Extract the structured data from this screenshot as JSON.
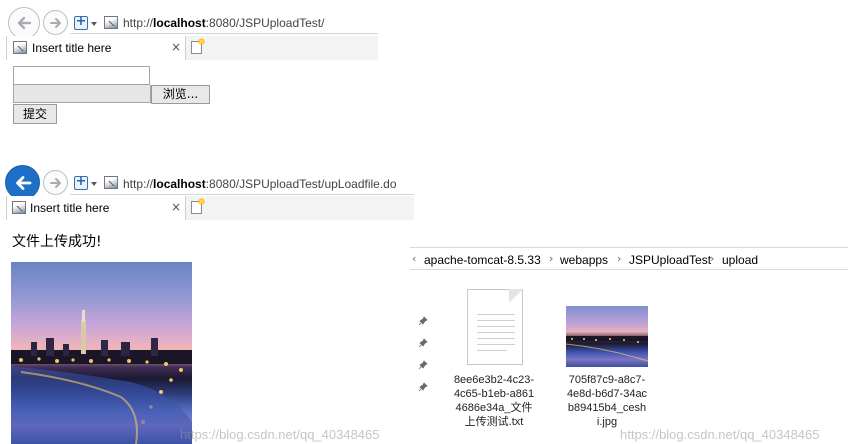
{
  "browser_top": {
    "url_prefix": "http://",
    "url_host": "localhost",
    "url_rest": ":8080/JSPUploadTest/",
    "tab_title": "Insert title here",
    "tab_close": "×"
  },
  "upload_form": {
    "file_text_value": "",
    "browse_label": "浏览...",
    "submit_label": "提交"
  },
  "browser_bottom": {
    "url_prefix": "http://",
    "url_host": "localhost",
    "url_rest": ":8080/JSPUploadTest/upLoadfile.do",
    "tab_title": "Insert title here",
    "tab_close": "×"
  },
  "result": {
    "message": "文件上传成功!"
  },
  "explorer": {
    "back_chevron": "‹",
    "breadcrumbs": [
      "apache-tomcat-8.5.33",
      "webapps",
      "JSPUploadTest",
      "upload"
    ],
    "separator": "›",
    "pin_glyph": "📌",
    "files": [
      {
        "type": "text-file",
        "name": "8ee6e3b2-4c23-4c65-b1eb-a8614686e34a_文件上传测试.txt"
      },
      {
        "type": "image-file",
        "name": "705f87c9-a8c7-4e8d-b6d7-34acb89415b4_ceshi.jpg"
      }
    ]
  },
  "watermarks": [
    "https://blog.csdn.net/qq_40348465",
    "https://blog.csdn.net/qq_40348465"
  ]
}
